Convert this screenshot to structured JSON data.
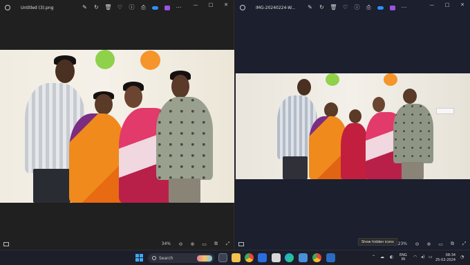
{
  "left_window": {
    "filename": "Untitled (3).png",
    "zoom": "34%",
    "toolbar_icons": [
      "edit-icon",
      "rotate-icon",
      "delete-icon",
      "favorite-icon",
      "info-icon",
      "print-icon",
      "onedrive-icon",
      "clipchamp-icon",
      "more-icon"
    ],
    "controls": {
      "minimize": "—",
      "maximize": "□",
      "close": "✕"
    }
  },
  "right_window": {
    "filename": "IMG-20240224-W...",
    "zoom": "23%",
    "toolbar_icons": [
      "edit-icon",
      "rotate-icon",
      "delete-icon",
      "favorite-icon",
      "info-icon",
      "print-icon",
      "onedrive-icon",
      "clipchamp-icon",
      "more-icon"
    ],
    "controls": {
      "minimize": "—",
      "maximize": "□",
      "close": "✕"
    }
  },
  "tooltip": "Show hidden icons",
  "taskbar": {
    "search_placeholder": "Search",
    "language": {
      "line1": "ENG",
      "line2": "IN"
    },
    "time": "08:34",
    "date": "25-02-2024"
  },
  "colors": {
    "balloon_green": "#8fd14a",
    "balloon_orange": "#f5952a",
    "accent_blue": "#3fa9f5"
  }
}
